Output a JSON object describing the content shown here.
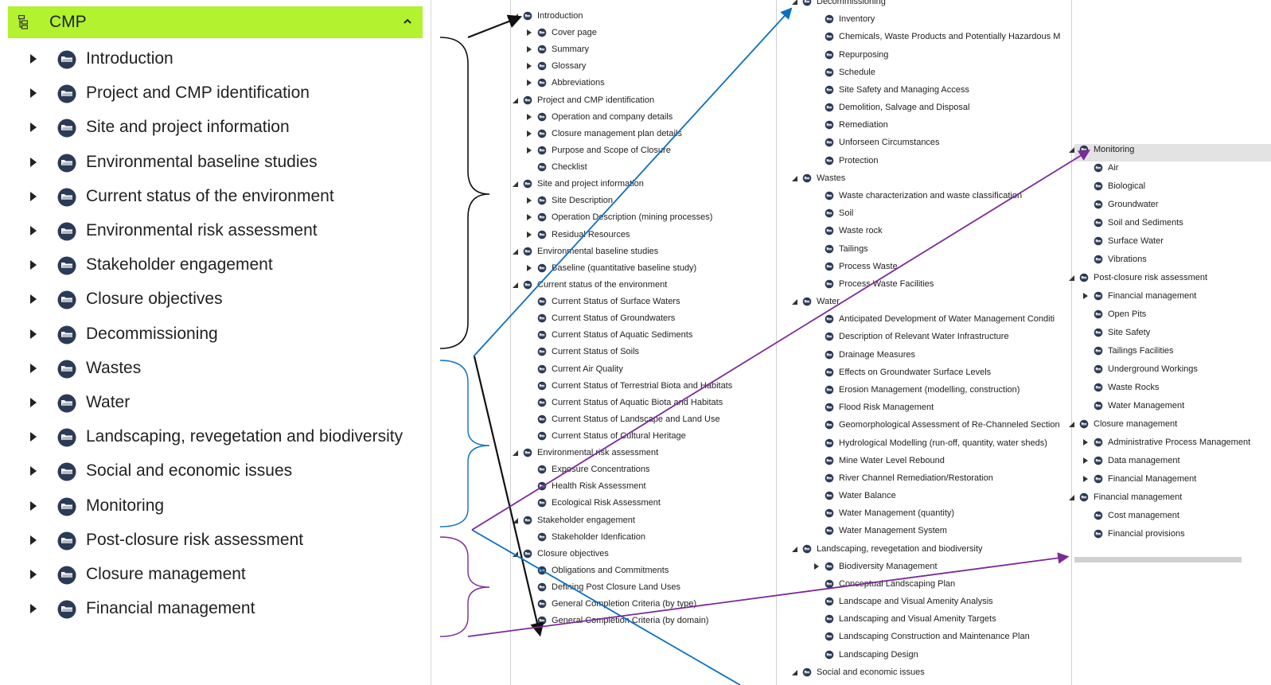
{
  "main": {
    "title": "CMP",
    "items": [
      "Introduction",
      "Project and CMP identification",
      "Site and project information",
      "Environmental baseline studies",
      "Current status of the environment",
      "Environmental risk assessment",
      "Stakeholder engagement",
      "Closure objectives",
      "Decommissioning",
      "Wastes",
      "Water",
      "Landscaping, revegetation and biodiversity",
      "Social and economic issues",
      "Monitoring",
      "Post-closure risk assessment",
      "Closure management",
      "Financial management"
    ]
  },
  "panels": [
    {
      "rows": [
        {
          "t": "Introduction",
          "lvl": 0,
          "exp": "open"
        },
        {
          "t": "Cover page",
          "lvl": 1,
          "exp": "closed"
        },
        {
          "t": "Summary",
          "lvl": 1,
          "exp": "closed"
        },
        {
          "t": "Glossary",
          "lvl": 1,
          "exp": "closed"
        },
        {
          "t": "Abbreviations",
          "lvl": 1,
          "exp": "closed"
        },
        {
          "t": "Project and CMP identification",
          "lvl": 0,
          "exp": "open"
        },
        {
          "t": "Operation and company details",
          "lvl": 1,
          "exp": "closed"
        },
        {
          "t": "Closure management plan details",
          "lvl": 1,
          "exp": "closed"
        },
        {
          "t": "Purpose and Scope of Closure",
          "lvl": 1,
          "exp": "closed"
        },
        {
          "t": "Checklist",
          "lvl": 1,
          "exp": "none"
        },
        {
          "t": "Site and project information",
          "lvl": 0,
          "exp": "open"
        },
        {
          "t": "Site Description",
          "lvl": 1,
          "exp": "closed"
        },
        {
          "t": "Operation Description  (mining processes)",
          "lvl": 1,
          "exp": "closed"
        },
        {
          "t": "Residual Resources",
          "lvl": 1,
          "exp": "closed"
        },
        {
          "t": "Environmental baseline studies",
          "lvl": 0,
          "exp": "open"
        },
        {
          "t": "Baseline  (quantitative baseline study)",
          "lvl": 1,
          "exp": "closed"
        },
        {
          "t": "Current status of the environment",
          "lvl": 0,
          "exp": "open"
        },
        {
          "t": "Current Status of Surface Waters",
          "lvl": 1,
          "exp": "none"
        },
        {
          "t": "Current Status of Groundwaters",
          "lvl": 1,
          "exp": "none"
        },
        {
          "t": "Current Status of Aquatic Sediments",
          "lvl": 1,
          "exp": "none"
        },
        {
          "t": "Current Status of Soils",
          "lvl": 1,
          "exp": "none"
        },
        {
          "t": "Current Air Quality",
          "lvl": 1,
          "exp": "none"
        },
        {
          "t": "Current Status of Terrestrial Biota and Habitats",
          "lvl": 1,
          "exp": "none"
        },
        {
          "t": "Current Status of Aquatic Biota and Habitats",
          "lvl": 1,
          "exp": "none"
        },
        {
          "t": "Current Status of Landscape and Land Use",
          "lvl": 1,
          "exp": "none"
        },
        {
          "t": "Current Status of Cultural Heritage",
          "lvl": 1,
          "exp": "none"
        },
        {
          "t": "Environmental risk assessment",
          "lvl": 0,
          "exp": "open"
        },
        {
          "t": "Exposure Concentrations",
          "lvl": 1,
          "exp": "none"
        },
        {
          "t": "Health Risk Assessment",
          "lvl": 1,
          "exp": "none"
        },
        {
          "t": "Ecological Risk Assessment",
          "lvl": 1,
          "exp": "none"
        },
        {
          "t": "Stakeholder engagement",
          "lvl": 0,
          "exp": "open"
        },
        {
          "t": "Stakeholder Idenfication",
          "lvl": 1,
          "exp": "none"
        },
        {
          "t": "Closure objectives",
          "lvl": 0,
          "exp": "open"
        },
        {
          "t": "Obligations and Commitments",
          "lvl": 1,
          "exp": "none"
        },
        {
          "t": "Defining Post Closure Land Uses",
          "lvl": 1,
          "exp": "none"
        },
        {
          "t": "General Completion Criteria (by type)",
          "lvl": 1,
          "exp": "none"
        },
        {
          "t": "General Completion Criteria (by domain)",
          "lvl": 1,
          "exp": "none"
        }
      ]
    },
    {
      "rows": [
        {
          "t": "Decommissioning",
          "lvl": 0,
          "exp": "open"
        },
        {
          "t": "Inventory",
          "lvl": 1,
          "exp": "none"
        },
        {
          "t": "Chemicals, Waste Products and Potentially Hazardous M",
          "lvl": 1,
          "exp": "none"
        },
        {
          "t": "Repurposing",
          "lvl": 1,
          "exp": "none"
        },
        {
          "t": "Schedule",
          "lvl": 1,
          "exp": "none"
        },
        {
          "t": "Site Safety and Managing Access",
          "lvl": 1,
          "exp": "none"
        },
        {
          "t": "Demolition, Salvage and Disposal",
          "lvl": 1,
          "exp": "none"
        },
        {
          "t": "Remediation",
          "lvl": 1,
          "exp": "none"
        },
        {
          "t": "Unforseen Circumstances",
          "lvl": 1,
          "exp": "none"
        },
        {
          "t": "Protection",
          "lvl": 1,
          "exp": "none"
        },
        {
          "t": "Wastes",
          "lvl": 0,
          "exp": "open"
        },
        {
          "t": "Waste characterization and waste classification",
          "lvl": 1,
          "exp": "none"
        },
        {
          "t": "Soil",
          "lvl": 1,
          "exp": "none"
        },
        {
          "t": "Waste rock",
          "lvl": 1,
          "exp": "none"
        },
        {
          "t": "Tailings",
          "lvl": 1,
          "exp": "none"
        },
        {
          "t": "Process Waste",
          "lvl": 1,
          "exp": "none"
        },
        {
          "t": "Process Waste Facilities",
          "lvl": 1,
          "exp": "none"
        },
        {
          "t": "Water",
          "lvl": 0,
          "exp": "open"
        },
        {
          "t": "Anticipated Development of Water Management Conditi",
          "lvl": 1,
          "exp": "none"
        },
        {
          "t": "Description of Relevant Water Infrastructure",
          "lvl": 1,
          "exp": "none"
        },
        {
          "t": "Drainage Measures",
          "lvl": 1,
          "exp": "none"
        },
        {
          "t": "Effects on Groundwater Surface Levels",
          "lvl": 1,
          "exp": "none"
        },
        {
          "t": "Erosion Management (modelling, construction)",
          "lvl": 1,
          "exp": "none"
        },
        {
          "t": "Flood Risk Management",
          "lvl": 1,
          "exp": "none"
        },
        {
          "t": "Geomorphological Assessment of Re-Channeled Section",
          "lvl": 1,
          "exp": "none"
        },
        {
          "t": "Hydrological Modelling (run-off, quantity, water sheds)",
          "lvl": 1,
          "exp": "none"
        },
        {
          "t": "Mine Water Level Rebound",
          "lvl": 1,
          "exp": "none"
        },
        {
          "t": "River Channel Remediation/Restoration",
          "lvl": 1,
          "exp": "none"
        },
        {
          "t": "Water Balance",
          "lvl": 1,
          "exp": "none"
        },
        {
          "t": "Water Management (quantity)",
          "lvl": 1,
          "exp": "none"
        },
        {
          "t": "Water Management System",
          "lvl": 1,
          "exp": "none"
        },
        {
          "t": "Landscaping, revegetation and biodiversity",
          "lvl": 0,
          "exp": "open"
        },
        {
          "t": "Biodiversity Management",
          "lvl": 1,
          "exp": "closed"
        },
        {
          "t": "Conceptual Landscaping Plan",
          "lvl": 1,
          "exp": "none"
        },
        {
          "t": "Landscape and Visual Amenity Analysis",
          "lvl": 1,
          "exp": "none"
        },
        {
          "t": "Landscaping and Visual Amenity Targets",
          "lvl": 1,
          "exp": "none"
        },
        {
          "t": "Landscaping Construction and Maintenance Plan",
          "lvl": 1,
          "exp": "none"
        },
        {
          "t": "Landscaping Design",
          "lvl": 1,
          "exp": "none"
        },
        {
          "t": "Social and economic issues",
          "lvl": 0,
          "exp": "open"
        }
      ]
    },
    {
      "rows": [
        {
          "t": "Monitoring",
          "lvl": 0,
          "exp": "open"
        },
        {
          "t": "Air",
          "lvl": 1,
          "exp": "none"
        },
        {
          "t": "Biological",
          "lvl": 1,
          "exp": "none"
        },
        {
          "t": "Groundwater",
          "lvl": 1,
          "exp": "none"
        },
        {
          "t": "Soil and Sediments",
          "lvl": 1,
          "exp": "none"
        },
        {
          "t": "Surface Water",
          "lvl": 1,
          "exp": "none"
        },
        {
          "t": "Vibrations",
          "lvl": 1,
          "exp": "none"
        },
        {
          "t": "Post-closure risk assessment",
          "lvl": 0,
          "exp": "open"
        },
        {
          "t": "Financial management",
          "lvl": 1,
          "exp": "closed"
        },
        {
          "t": "Open Pits",
          "lvl": 1,
          "exp": "none"
        },
        {
          "t": "Site Safety",
          "lvl": 1,
          "exp": "none"
        },
        {
          "t": "Tailings Facilities",
          "lvl": 1,
          "exp": "none"
        },
        {
          "t": "Underground Workings",
          "lvl": 1,
          "exp": "none"
        },
        {
          "t": "Waste Rocks",
          "lvl": 1,
          "exp": "none"
        },
        {
          "t": "Water Management",
          "lvl": 1,
          "exp": "none"
        },
        {
          "t": "Closure management",
          "lvl": 0,
          "exp": "open"
        },
        {
          "t": "Administrative Process Management",
          "lvl": 1,
          "exp": "closed"
        },
        {
          "t": "Data management",
          "lvl": 1,
          "exp": "closed"
        },
        {
          "t": "Financial Management",
          "lvl": 1,
          "exp": "closed"
        },
        {
          "t": "Financial management",
          "lvl": 0,
          "exp": "open"
        },
        {
          "t": "Cost management",
          "lvl": 1,
          "exp": "none"
        },
        {
          "t": "Financial provisions",
          "lvl": 1,
          "exp": "none"
        }
      ]
    }
  ],
  "colors": {
    "header_bg": "#b2f22e",
    "bracket_black": "#111111",
    "bracket_blue": "#0a6fc2",
    "bracket_purple": "#7b2b97",
    "selected_row": "#e3e3e3"
  },
  "icons": {
    "header": "tree-structure-icon",
    "item": "folder-disc-icon",
    "expand": "triangle-right-icon",
    "collapse": "chevron-up-icon"
  }
}
